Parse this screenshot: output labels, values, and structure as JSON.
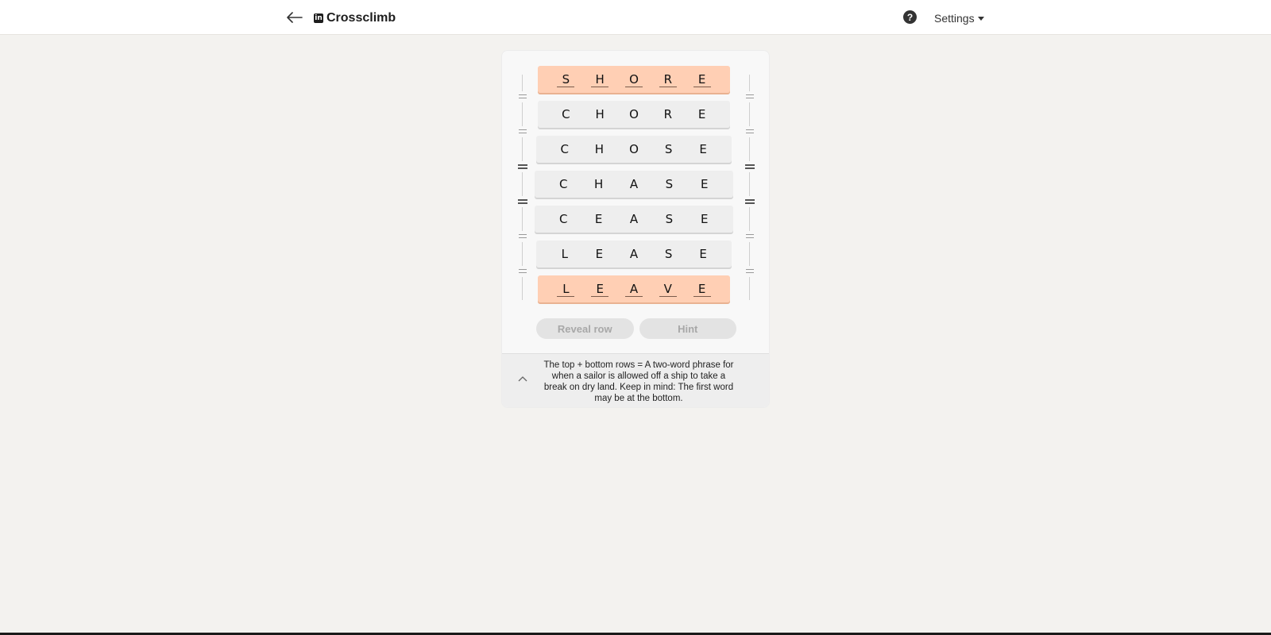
{
  "header": {
    "title": "Crossclimb",
    "settings_label": "Settings",
    "help_glyph": "?",
    "logo_text": "in"
  },
  "game": {
    "rows": [
      {
        "letters": [
          "S",
          "H",
          "O",
          "R",
          "E"
        ],
        "state": "fixed"
      },
      {
        "letters": [
          "C",
          "H",
          "O",
          "R",
          "E"
        ],
        "state": "middle"
      },
      {
        "letters": [
          "C",
          "H",
          "O",
          "S",
          "E"
        ],
        "state": "middle"
      },
      {
        "letters": [
          "C",
          "H",
          "A",
          "S",
          "E"
        ],
        "state": "middle"
      },
      {
        "letters": [
          "C",
          "E",
          "A",
          "S",
          "E"
        ],
        "state": "middle"
      },
      {
        "letters": [
          "L",
          "E",
          "A",
          "S",
          "E"
        ],
        "state": "middle"
      },
      {
        "letters": [
          "L",
          "E",
          "A",
          "V",
          "E"
        ],
        "state": "fixed"
      }
    ],
    "reveal_label": "Reveal row",
    "hint_label": "Hint",
    "clue": "The top + bottom rows = A two-word phrase for when a sailor is allowed off a ship to take a break on dry land. Keep in mind: The first word may be at the bottom."
  },
  "colors": {
    "fixed_row": "#ffcfb4",
    "middle_row": "#eeeeee",
    "background": "#f3f2ef"
  }
}
